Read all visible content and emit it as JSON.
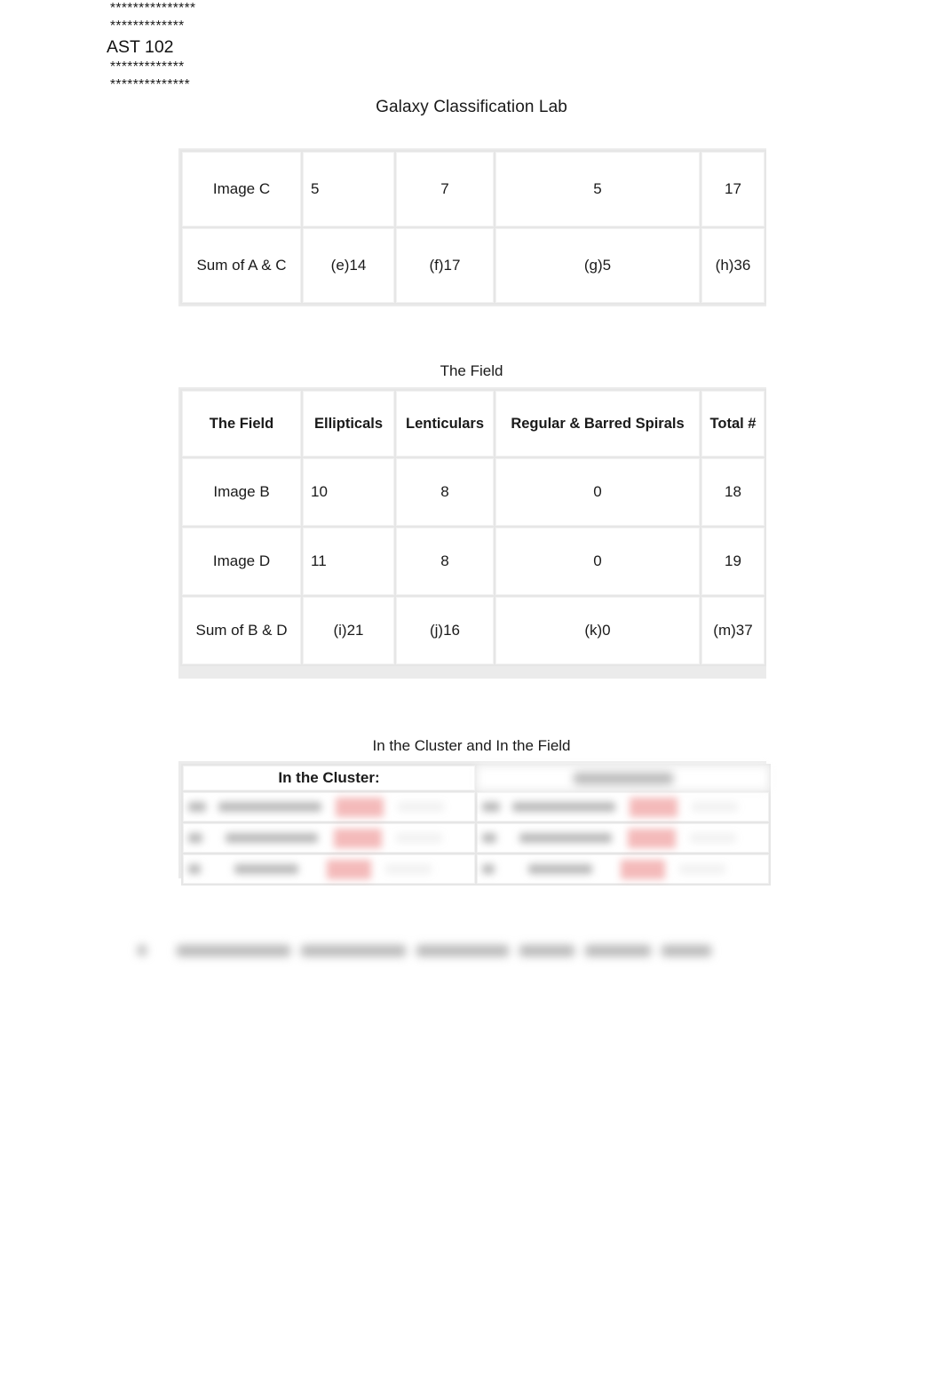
{
  "document": {
    "header": {
      "redacted_line_1": "***************",
      "redacted_line_2": "*************",
      "course": "AST 102",
      "redacted_line_3": "*************",
      "redacted_line_4": "**************"
    },
    "title": "Galaxy Classification Lab"
  },
  "table_cluster": {
    "rows": [
      {
        "label": "Image C",
        "ellipticals": "5",
        "lenticulars": "7",
        "spirals": "5",
        "total": "17"
      },
      {
        "label": "Sum of A & C",
        "ellipticals": "(e)14",
        "lenticulars": "(f)17",
        "spirals": "(g)5",
        "total": "(h)36"
      }
    ]
  },
  "table_field": {
    "caption": "The Field",
    "headers": {
      "label": "The Field",
      "ellipticals": "Ellipticals",
      "lenticulars": "Lenticulars",
      "spirals": "Regular & Barred Spirals",
      "total": "Total #"
    },
    "rows": [
      {
        "label": "Image B",
        "ellipticals": "10",
        "lenticulars": "8",
        "spirals": "0",
        "total": "18"
      },
      {
        "label": "Image D",
        "ellipticals": "11",
        "lenticulars": "8",
        "spirals": "0",
        "total": "19"
      },
      {
        "label": "Sum of B & D",
        "ellipticals": "(i)21",
        "lenticulars": "(j)16",
        "spirals": "(k)0",
        "total": "(m)37"
      }
    ]
  },
  "section_cluster_field": {
    "caption": "In the Cluster and In the Field",
    "left_heading": "In the Cluster:"
  }
}
